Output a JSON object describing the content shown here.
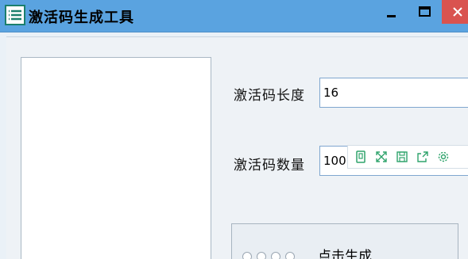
{
  "window": {
    "title": "激活码生成工具",
    "controls": {
      "minimize": "−",
      "maximize": "□",
      "close": "×"
    }
  },
  "form": {
    "length_label": "激活码长度",
    "length_value": "16",
    "count_label": "激活码数量",
    "count_value": "100"
  },
  "generate_button_label": "点击生成",
  "icons": {
    "app": "app-logo-icon",
    "toolbar": [
      "copy-icon",
      "fullscreen-icon",
      "save-icon",
      "share-icon",
      "settings-icon"
    ]
  },
  "colors": {
    "titlebar": "#5aa3e0",
    "close": "#d9534f",
    "toolbar_icon": "#2ea36b"
  }
}
